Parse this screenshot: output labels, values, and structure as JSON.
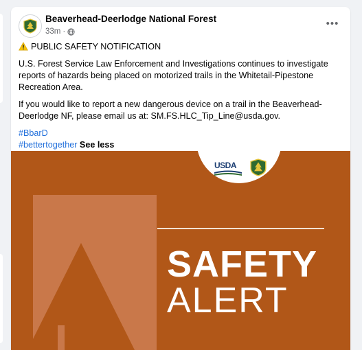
{
  "post": {
    "page_name": "Beaverhead-Deerlodge National Forest",
    "time": "33m",
    "separator": "·",
    "more_label": "•••",
    "headline": "PUBLIC SAFETY NOTIFICATION",
    "paragraph1": "U.S. Forest Service Law Enforcement and Investigations continues to investigate reports of hazards being placed on motorized trails in the Whitetail-Pipestone Recreation Area.",
    "paragraph2": "If you would like to report a new dangerous device on a trail in the Beaverhead-Deerlodge NF,  please email us at:  SM.FS.HLC_Tip_Line@usda.gov.",
    "hashtags": [
      "#BbarD",
      "#bettertogether"
    ],
    "see_less": "See less"
  },
  "image": {
    "usda_text": "USDA",
    "line1": "SAFETY",
    "line2": "ALERT"
  },
  "icons": {
    "avatar": "forest-service-shield-icon",
    "privacy": "globe-icon",
    "more": "ellipsis-icon",
    "warning": "warning-sign-icon"
  },
  "colors": {
    "image_background": "#b15718",
    "hashtag": "#216fdb",
    "usda_blue": "#1d3f73",
    "forest_green": "#2f6a31",
    "forest_gold": "#e4c43a"
  }
}
